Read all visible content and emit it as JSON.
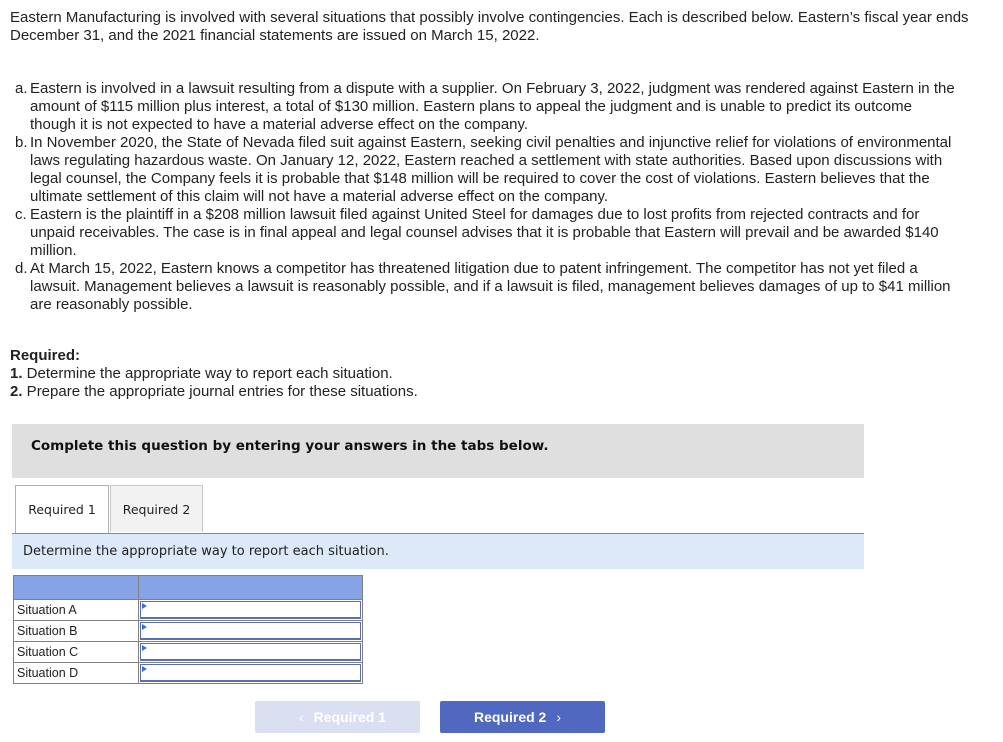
{
  "intro": "Eastern Manufacturing is involved with several situations that possibly involve contingencies. Each is described below. Eastern’s fiscal year ends December 31, and the 2021 financial statements are issued on March 15, 2022.",
  "situations": [
    {
      "label": "a.",
      "text": "Eastern is involved in a lawsuit resulting from a dispute with a supplier. On February 3, 2022, judgment was rendered against Eastern in the amount of $115 million plus interest, a total of $130 million. Eastern plans to appeal the judgment and is unable to predict its outcome though it is not expected to have a material adverse effect on the company."
    },
    {
      "label": "b.",
      "text": "In November 2020, the State of Nevada filed suit against Eastern, seeking civil penalties and injunctive relief for violations of environmental laws regulating hazardous waste. On January 12, 2022, Eastern reached a settlement with state authorities. Based upon discussions with legal counsel, the Company feels it is probable that $148 million will be required to cover the cost of violations. Eastern believes that the ultimate settlement of this claim will not have a material adverse effect on the company."
    },
    {
      "label": "c.",
      "text": "Eastern is the plaintiff in a $208 million lawsuit filed against United Steel for damages due to lost profits from rejected contracts and for unpaid receivables. The case is in final appeal and legal counsel advises that it is probable that Eastern will prevail and be awarded $140 million."
    },
    {
      "label": "d.",
      "text": "At March 15, 2022, Eastern knows a competitor has threatened litigation due to patent infringement. The competitor has not yet filed a lawsuit. Management believes a lawsuit is reasonably possible, and if a lawsuit is filed, management believes damages of up to $41 million are reasonably possible."
    }
  ],
  "required": {
    "heading": "Required:",
    "items": [
      {
        "num": "1.",
        "text": " Determine the appropriate way to report each situation."
      },
      {
        "num": "2.",
        "text": " Prepare the appropriate journal entries for these situations."
      }
    ]
  },
  "banner": "Complete this question by entering your answers in the tabs below.",
  "tabs": [
    {
      "label": "Required 1",
      "active": true
    },
    {
      "label": "Required 2",
      "active": false
    }
  ],
  "instruction": "Determine the appropriate way to report each situation.",
  "table": {
    "header": [
      "",
      ""
    ],
    "rows": [
      {
        "name": "Situation A",
        "value": ""
      },
      {
        "name": "Situation B",
        "value": ""
      },
      {
        "name": "Situation C",
        "value": ""
      },
      {
        "name": "Situation D",
        "value": ""
      }
    ]
  },
  "nav": {
    "prev_label": "Required 1",
    "next_label": "Required 2",
    "prev_icon": "chevron-left-icon",
    "next_icon": "chevron-right-icon"
  },
  "colors": {
    "banner_bg": "#dfdfdf",
    "instruction_bg": "#dce9f9",
    "table_header_bg": "#86a3e6",
    "next_button_bg": "#5068bf",
    "prev_button_bg": "#dae0f2"
  }
}
